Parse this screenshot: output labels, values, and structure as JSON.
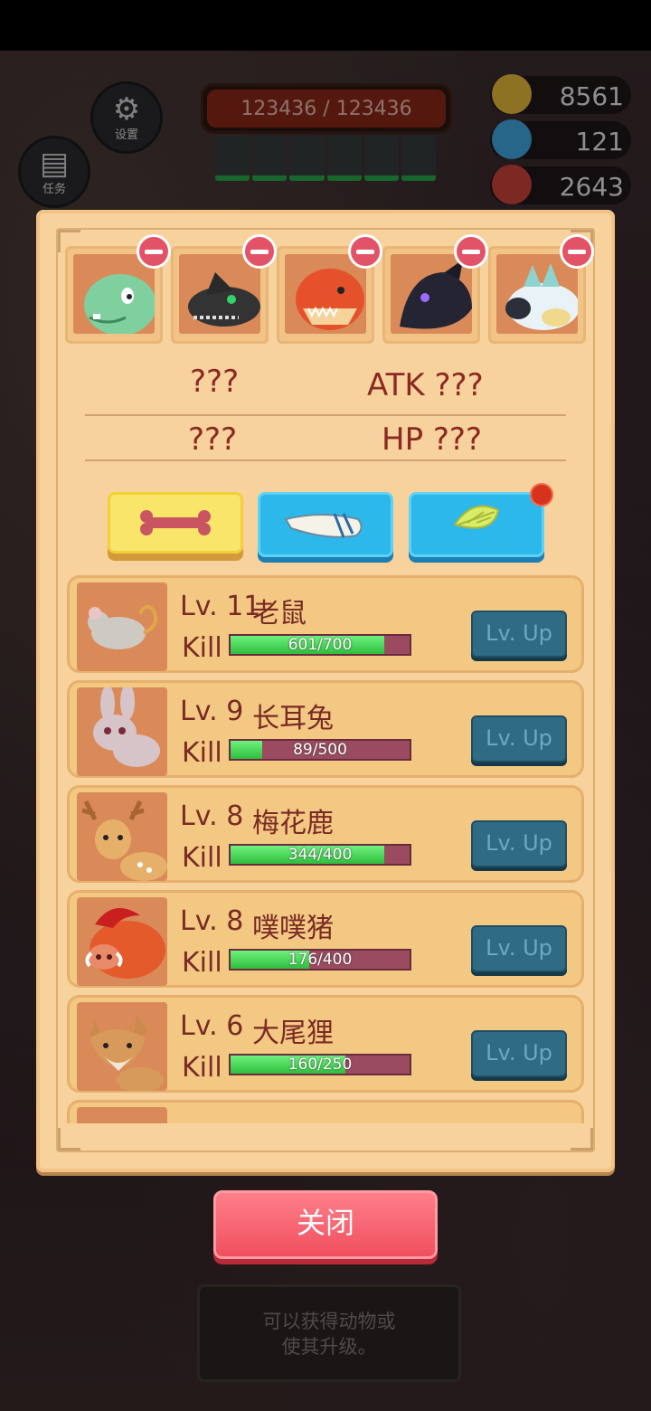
{
  "hud": {
    "settings_label": "设置",
    "tasks_label": "任务",
    "hp_text": "123436 / 123436",
    "resources": [
      {
        "name": "gold",
        "value": "8561"
      },
      {
        "name": "gem",
        "value": "121"
      },
      {
        "name": "bone",
        "value": "2643"
      }
    ],
    "hint": [
      "可以获得动物或",
      "使其升级。"
    ]
  },
  "team": {
    "slots": [
      {
        "icon": "green-dino-icon"
      },
      {
        "icon": "black-beast-icon"
      },
      {
        "icon": "orange-dragon-icon"
      },
      {
        "icon": "dark-dragon-icon"
      },
      {
        "icon": "ice-beast-icon"
      }
    ],
    "stat_left_1": "???",
    "stat_right_1": "ATK  ???",
    "stat_left_2": "???",
    "stat_right_2": "HP  ???"
  },
  "tabs": [
    {
      "icon": "bone-icon",
      "selected": true
    },
    {
      "icon": "fang-icon",
      "selected": false
    },
    {
      "icon": "wing-icon",
      "selected": false,
      "notification": true
    }
  ],
  "animals": [
    {
      "level": "Lv. 11",
      "name": "老鼠",
      "kill_label": "Kill",
      "progress": "601/700",
      "fraction": 0.859,
      "button": "Lv. Up",
      "icon": "rat-icon"
    },
    {
      "level": "Lv. 9",
      "name": "长耳兔",
      "kill_label": "Kill",
      "progress": "89/500",
      "fraction": 0.178,
      "button": "Lv. Up",
      "icon": "rabbit-icon"
    },
    {
      "level": "Lv. 8",
      "name": "梅花鹿",
      "kill_label": "Kill",
      "progress": "344/400",
      "fraction": 0.86,
      "button": "Lv. Up",
      "icon": "deer-icon"
    },
    {
      "level": "Lv. 8",
      "name": "噗噗猪",
      "kill_label": "Kill",
      "progress": "176/400",
      "fraction": 0.44,
      "button": "Lv. Up",
      "icon": "boar-icon"
    },
    {
      "level": "Lv. 6",
      "name": "大尾狸",
      "kill_label": "Kill",
      "progress": "160/250",
      "fraction": 0.64,
      "button": "Lv. Up",
      "icon": "fox-icon"
    }
  ],
  "close_label": "关闭",
  "colors": {
    "accent_text": "#7a2a24",
    "panel": "#f7d29c",
    "button_blue": "#2cb8ea",
    "close_red": "#f04f5e"
  }
}
